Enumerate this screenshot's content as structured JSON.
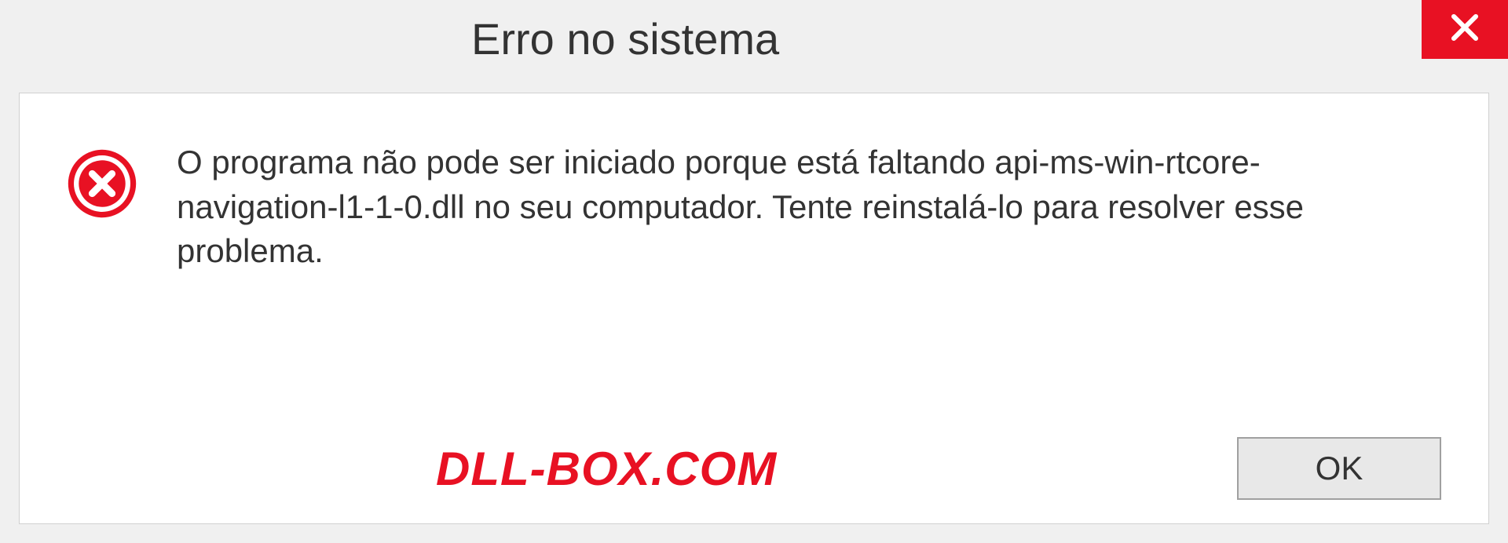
{
  "titlebar": {
    "title": "Erro no sistema"
  },
  "dialog": {
    "message": "O programa não pode ser iniciado porque está faltando api-ms-win-rtcore-navigation-l1-1-0.dll no seu computador. Tente reinstalá-lo para resolver esse problema.",
    "watermark": "DLL-BOX.COM",
    "ok_label": "OK"
  }
}
